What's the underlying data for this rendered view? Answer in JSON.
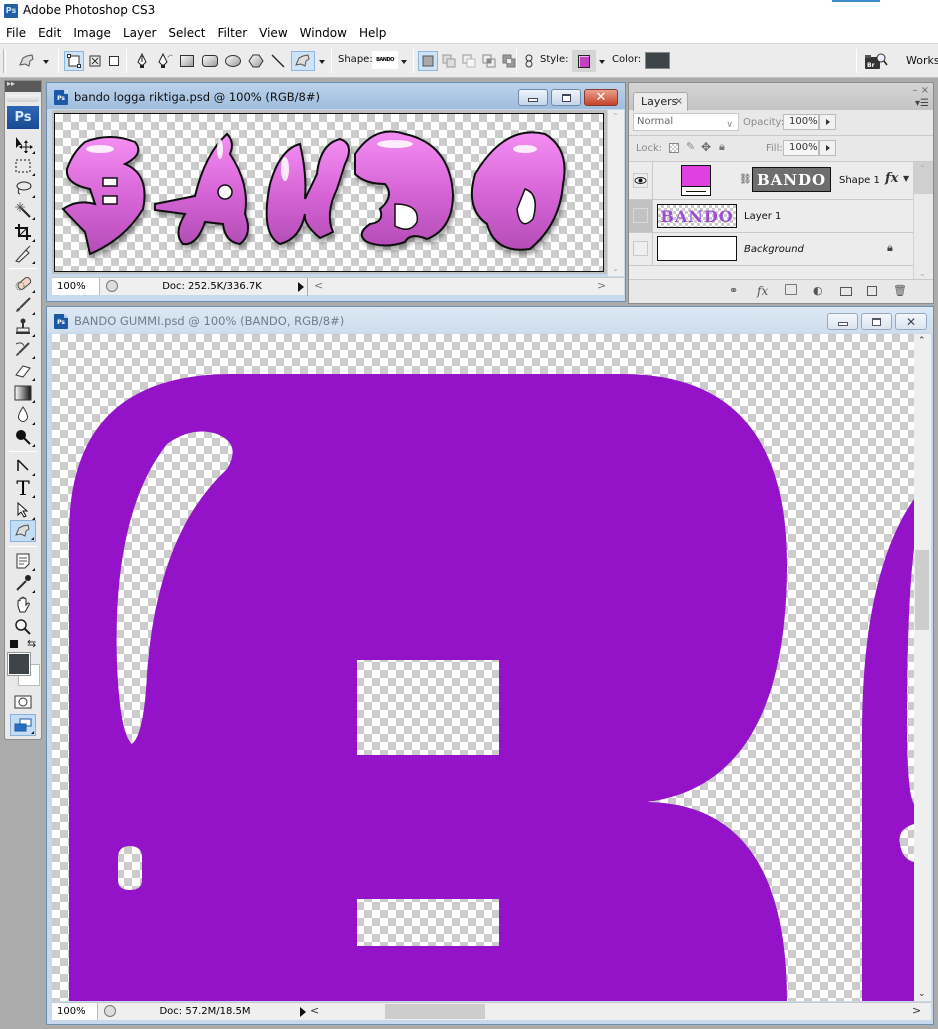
{
  "app": {
    "title": "Adobe Photoshop CS3",
    "badge": "Ps"
  },
  "menu": [
    "File",
    "Edit",
    "Image",
    "Layer",
    "Select",
    "Filter",
    "View",
    "Window",
    "Help"
  ],
  "options_bar": {
    "shape_label": "Shape:",
    "shape_preview": "BANDO",
    "style_label": "Style:",
    "color_label": "Color:",
    "workspace_label": "Worksp",
    "style_swatch_color": "#c342c4",
    "color_swatch_color": "#3d4548",
    "bridge_label": "Br"
  },
  "toolbox": {
    "logo": "Ps",
    "tools": [
      "move",
      "marquee",
      "lasso",
      "magic-wand",
      "crop",
      "slice",
      "healing-brush",
      "brush",
      "clone-stamp",
      "history-brush",
      "eraser",
      "gradient",
      "blur",
      "dodge",
      "path-selection",
      "type",
      "direct-selection",
      "custom-shape",
      "notes",
      "eyedropper",
      "hand",
      "zoom"
    ],
    "selected_tool": "custom-shape",
    "foreground_color": "#3d4548",
    "background_color": "#ffffff"
  },
  "doc_small": {
    "title": "bando logga riktiga.psd @ 100% (RGB/8#)",
    "zoom": "100%",
    "doc_info": "Doc: 252.5K/336.7K",
    "artwork_text": "BANDO"
  },
  "doc_main": {
    "title": "BANDO GUMMI.psd @ 100% (BANDO, RGB/8#)",
    "zoom": "100%",
    "doc_info": "Doc: 57.2M/18.5M",
    "shape_color": "#9413c8"
  },
  "layers_panel": {
    "tab_label": "Layers",
    "blend_mode": "Normal",
    "opacity_label": "Opacity:",
    "opacity_value": "100%",
    "lock_label": "Lock:",
    "fill_label": "Fill:",
    "fill_value": "100%",
    "layers": [
      {
        "name": "Shape 1",
        "visible": true,
        "has_fx": true,
        "fx_label": "fx",
        "fill_color": "#e040e0",
        "selected": false
      },
      {
        "name": "Layer 1",
        "visible": false,
        "has_fx": false,
        "selected": false
      },
      {
        "name": "Background",
        "visible": false,
        "locked": true,
        "italic": true
      }
    ]
  }
}
